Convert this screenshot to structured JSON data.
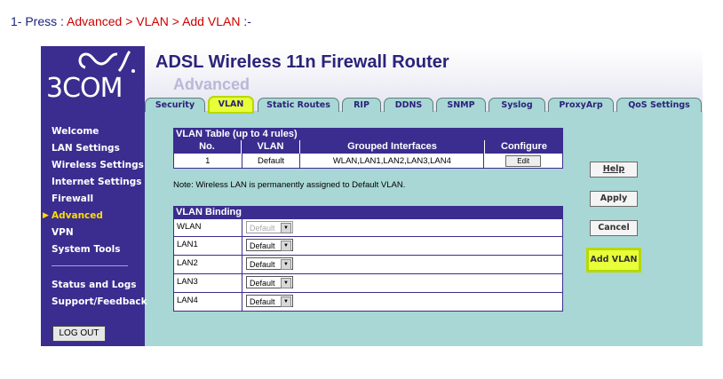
{
  "instruction": {
    "prefix": "1-  Press :",
    "step1": "Advanced",
    "sep1": ">",
    "step2": "VLAN",
    "sep2": ">",
    "step3": "Add VLAN",
    "suffix": ":-"
  },
  "brand": {
    "logo_text": "3COM",
    "logo_icon": "3com-wave-icon"
  },
  "header": {
    "title": "ADSL Wireless 11n Firewall Router",
    "section": "Advanced"
  },
  "tabs": [
    {
      "label": "Security"
    },
    {
      "label": "VLAN",
      "active": true
    },
    {
      "label": "Static Routes"
    },
    {
      "label": "RIP"
    },
    {
      "label": "DDNS"
    },
    {
      "label": "SNMP"
    },
    {
      "label": "Syslog"
    },
    {
      "label": "ProxyArp"
    },
    {
      "label": "QoS Settings"
    }
  ],
  "sidebar": {
    "items": [
      {
        "label": "Welcome"
      },
      {
        "label": "LAN Settings"
      },
      {
        "label": "Wireless Settings"
      },
      {
        "label": "Internet Settings"
      },
      {
        "label": "Firewall"
      },
      {
        "label": "Advanced",
        "active": true
      },
      {
        "label": "VPN"
      },
      {
        "label": "System Tools"
      }
    ],
    "bottom_items": [
      {
        "label": "Status and Logs"
      },
      {
        "label": "Support/Feedback"
      }
    ],
    "logout": "LOG OUT"
  },
  "vlan_table": {
    "title": "VLAN Table (up to 4 rules)",
    "columns": [
      "No.",
      "VLAN",
      "Grouped Interfaces",
      "Configure"
    ],
    "rows": [
      {
        "no": "1",
        "vlan": "Default",
        "interfaces": "WLAN,LAN1,LAN2,LAN3,LAN4",
        "action": "Edit"
      }
    ]
  },
  "note": "Note: Wireless LAN is permanently assigned to Default VLAN.",
  "vlan_binding": {
    "title": "VLAN Binding",
    "rows": [
      {
        "port": "WLAN",
        "value": "Default",
        "disabled": true
      },
      {
        "port": "LAN1",
        "value": "Default"
      },
      {
        "port": "LAN2",
        "value": "Default"
      },
      {
        "port": "LAN3",
        "value": "Default"
      },
      {
        "port": "LAN4",
        "value": "Default"
      }
    ]
  },
  "buttons": {
    "help": "Help",
    "apply": "Apply",
    "cancel": "Cancel",
    "add_vlan": "Add VLAN"
  },
  "colors": {
    "nav_bg": "#3a2d8f",
    "content_bg": "#a8d7d5",
    "highlight": "#e8ff3a",
    "instruction_red": "#cc0000"
  }
}
